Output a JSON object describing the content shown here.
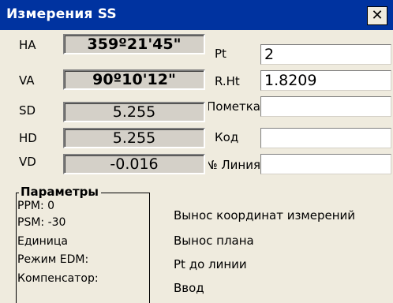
{
  "window": {
    "title": "Измерения SS",
    "close_glyph": "✕"
  },
  "measurements": [
    {
      "label": "HA",
      "value": "359º21'45\""
    },
    {
      "label": "VA",
      "value": "90º10'12\""
    },
    {
      "label": "SD",
      "value": "5.255"
    },
    {
      "label": "HD",
      "value": "5.255"
    },
    {
      "label": "VD",
      "value": "-0.016"
    }
  ],
  "point_fields": [
    {
      "label": "Pt",
      "value": "2"
    },
    {
      "label": "R.Ht",
      "value": "1.8209"
    },
    {
      "label": "Пометка",
      "value": ""
    },
    {
      "label": "Код",
      "value": ""
    },
    {
      "label": "Линия №",
      "value": ""
    }
  ],
  "parameters": {
    "title": "Параметры",
    "items": [
      "PPM:  0",
      "PSM: -30",
      "Единица",
      "Режим EDM:",
      "Компенсатор:"
    ]
  },
  "menu": {
    "items": [
      "Вынос координат измерений",
      "Вынос плана",
      "Pt до линии",
      "Ввод"
    ]
  }
}
